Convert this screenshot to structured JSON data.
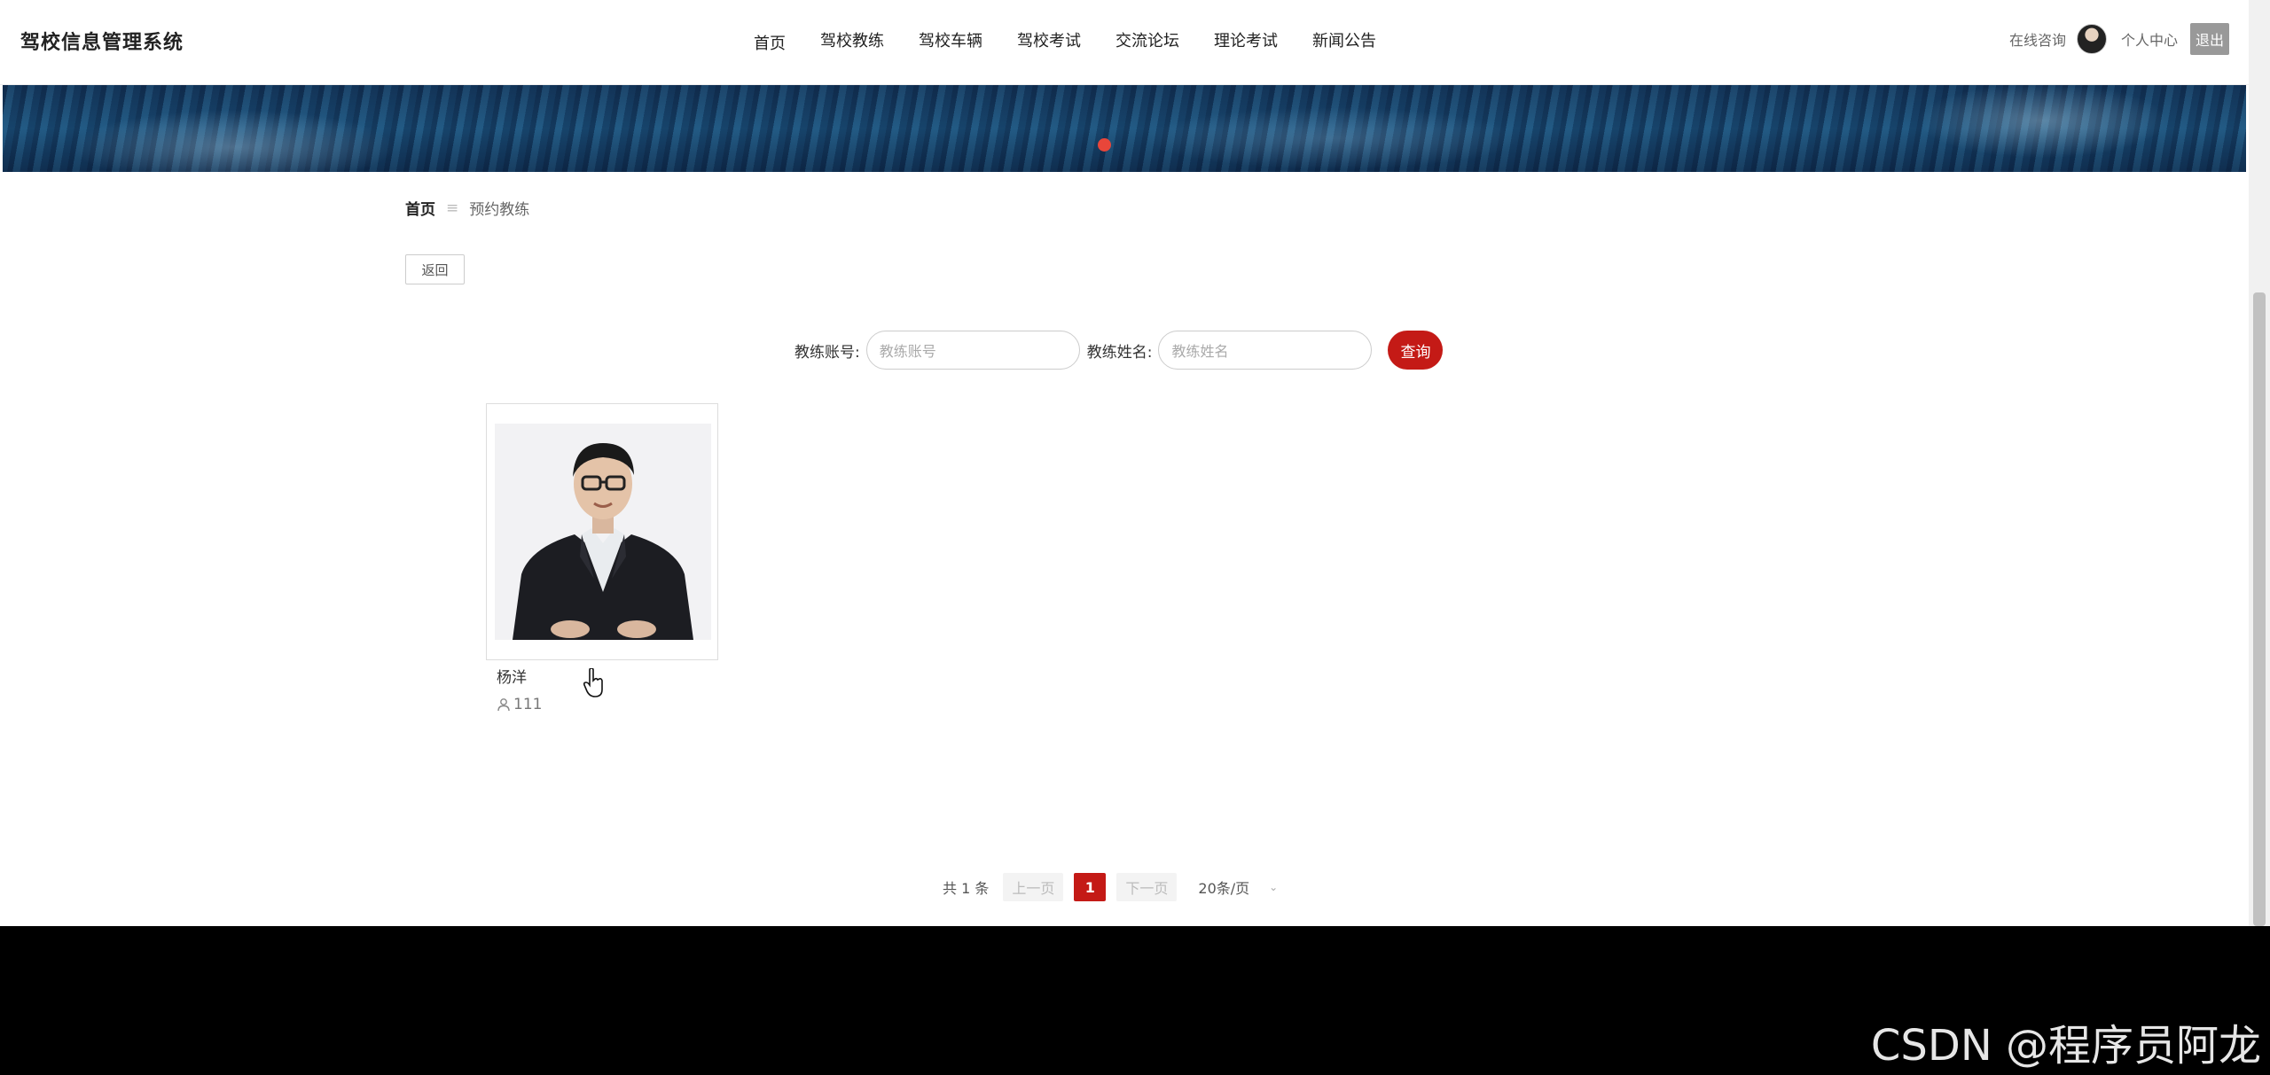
{
  "header": {
    "brand": "驾校信息管理系统",
    "nav": [
      "首页",
      "驾校教练",
      "驾校车辆",
      "驾校考试",
      "交流论坛",
      "理论考试",
      "新闻公告"
    ],
    "consult": "在线咨询",
    "user_center": "个人中心",
    "logout": "退出"
  },
  "breadcrumb": {
    "home": "首页",
    "separator": "≡",
    "current": "预约教练"
  },
  "back_button": "返回",
  "search": {
    "account_label": "教练账号:",
    "account_placeholder": "教练账号",
    "name_label": "教练姓名:",
    "name_placeholder": "教练姓名",
    "button": "查询"
  },
  "coaches": [
    {
      "name": "杨洋",
      "count": "111"
    }
  ],
  "pagination": {
    "total": "共 1 条",
    "prev": "上一页",
    "current_page": "1",
    "next": "下一页",
    "page_size": "20条/页"
  },
  "watermark": "CSDN @程序员阿龙",
  "colors": {
    "accent": "#c41a16",
    "banner_dot": "#e8463a",
    "footer": "#000000"
  }
}
